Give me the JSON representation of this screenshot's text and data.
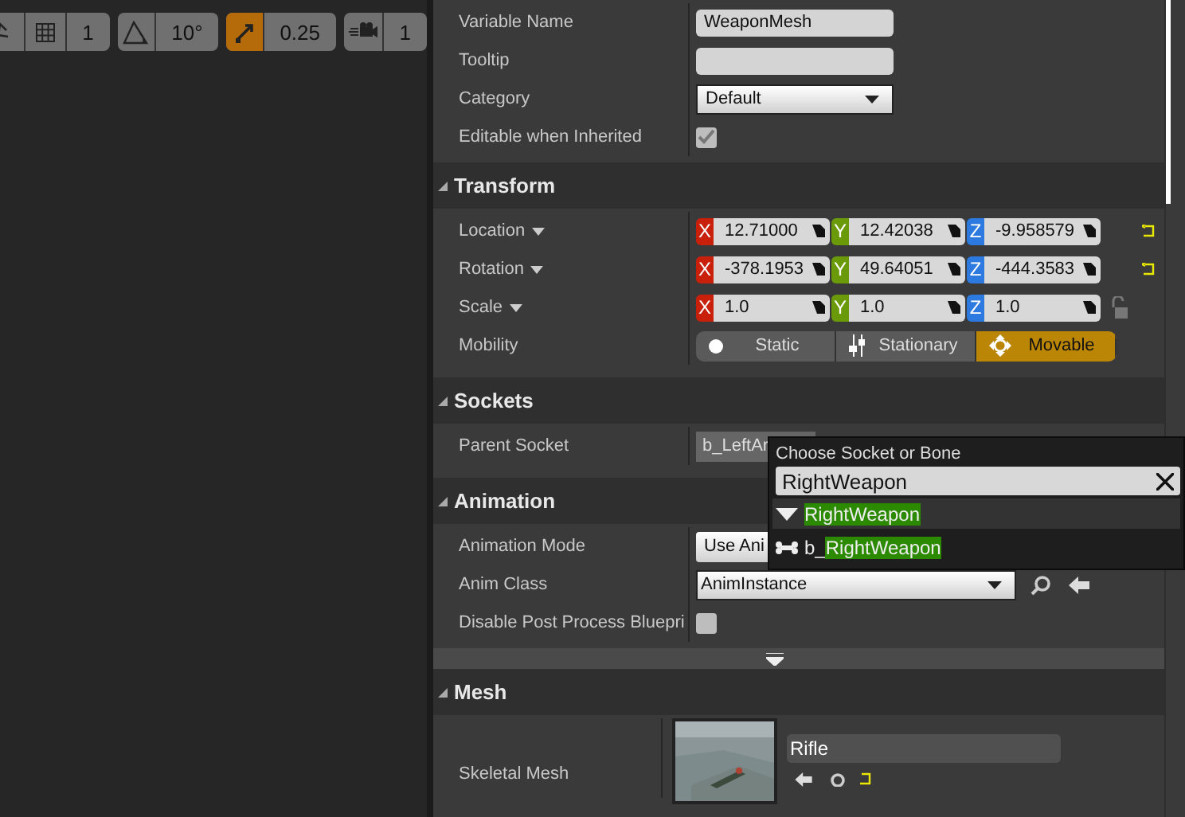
{
  "toolbar": [
    {
      "value": "1",
      "active": false
    },
    {
      "value": "10°",
      "active": false
    },
    {
      "value": "0.25",
      "active": true
    },
    {
      "value": "1",
      "active": false
    }
  ],
  "sections": [
    {
      "rows": [
        {
          "label": "Variable Name",
          "kind": "text",
          "value": "WeaponMesh"
        },
        {
          "label": "Tooltip",
          "kind": "text"
        },
        {
          "label": "Category",
          "kind": "dropdown",
          "value": "Default"
        },
        {
          "label": "Editable when Inherited",
          "kind": "checkbox",
          "checked": true
        }
      ]
    },
    {
      "title": "Transform",
      "rows": [
        {
          "label": "Location",
          "menu": true,
          "kind": "vector",
          "reset": true,
          "components": [
            {
              "axis": "X",
              "value": "12.71000"
            },
            {
              "axis": "Y",
              "value": "12.42038"
            },
            {
              "axis": "Z",
              "value": "-9.958579"
            }
          ]
        },
        {
          "label": "Rotation",
          "menu": true,
          "kind": "vector",
          "reset": true,
          "components": [
            {
              "axis": "X",
              "value": "-378.1953"
            },
            {
              "axis": "Y",
              "value": "49.64051"
            },
            {
              "axis": "Z",
              "value": "-444.3583"
            }
          ]
        },
        {
          "label": "Scale",
          "menu": true,
          "kind": "vector",
          "lock": true,
          "components": [
            {
              "axis": "X",
              "value": "1.0"
            },
            {
              "axis": "Y",
              "value": "1.0"
            },
            {
              "axis": "Z",
              "value": "1.0"
            }
          ]
        },
        {
          "label": "Mobility",
          "kind": "mobility",
          "options": [
            {
              "label": "Static",
              "selected": false
            },
            {
              "label": "Stationary",
              "selected": false
            },
            {
              "label": "Movable",
              "selected": true
            }
          ]
        }
      ]
    },
    {
      "title": "Sockets",
      "rows": [
        {
          "label": "Parent Socket",
          "kind": "socket",
          "value": "b_LeftAr"
        }
      ]
    },
    {
      "title": "Animation",
      "rows": [
        {
          "label": "Animation Mode",
          "kind": "button",
          "value": "Use Ani"
        },
        {
          "label": "Anim Class",
          "kind": "class_picker",
          "value": "AnimInstance"
        },
        {
          "label": "Disable Post Process Bluepri",
          "kind": "checkbox",
          "checked": false
        }
      ],
      "more": true
    },
    {
      "title": "Mesh",
      "rows": [
        {
          "label": "Skeletal Mesh",
          "kind": "asset",
          "value": "Rifle"
        }
      ]
    }
  ],
  "popup": {
    "title": "Choose Socket or Bone",
    "search": "RightWeapon",
    "items": [
      {
        "kind": "group",
        "match": "RightWeapon",
        "selected": true
      },
      {
        "kind": "bone",
        "prefix": "b_",
        "match": "RightWeapon",
        "selected": false
      }
    ]
  }
}
